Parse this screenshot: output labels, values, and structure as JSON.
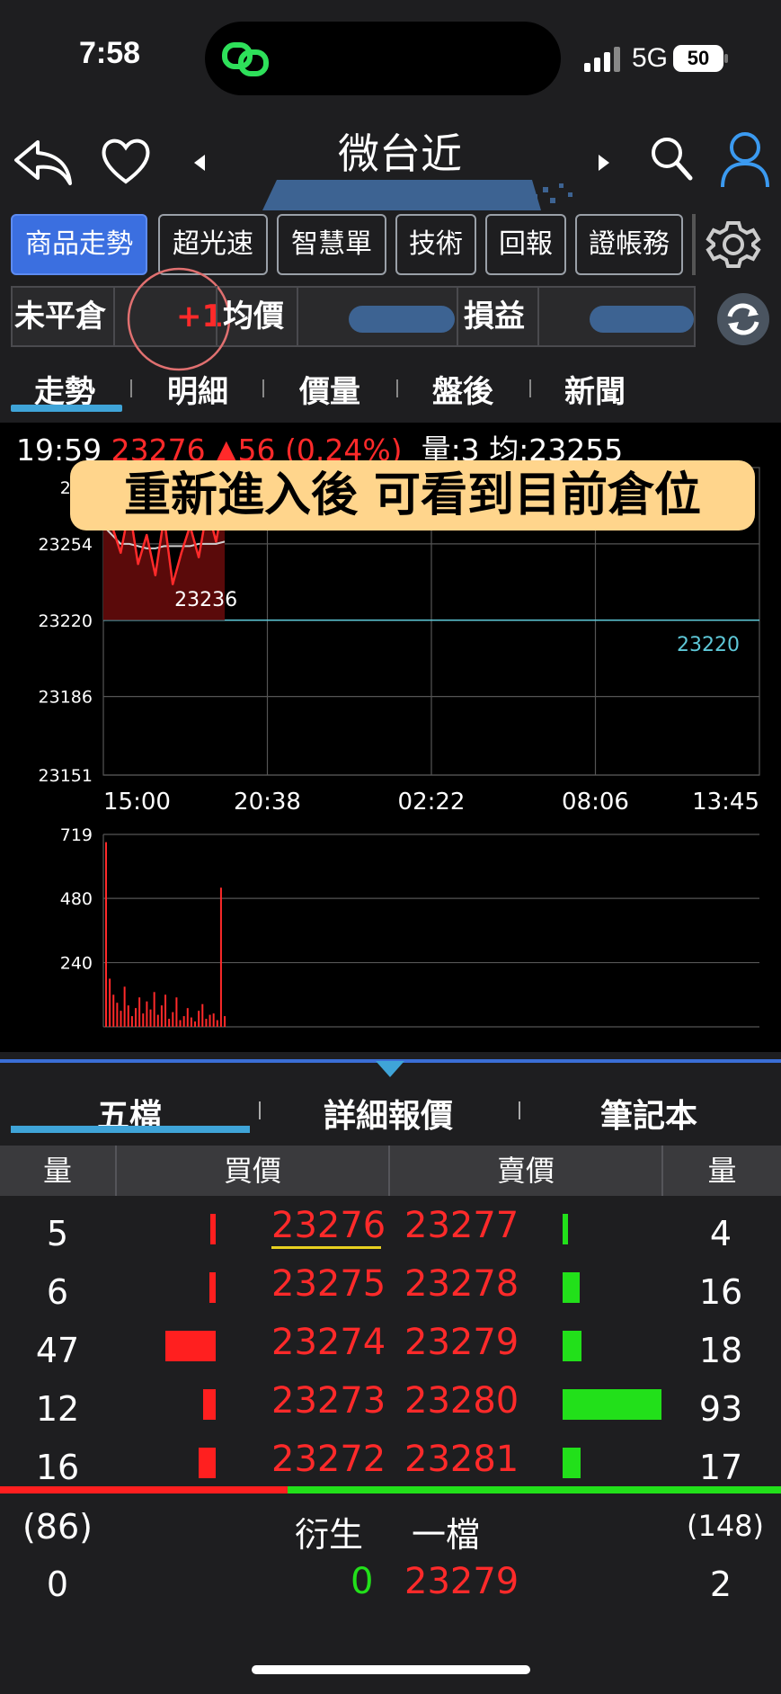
{
  "status": {
    "time": "7:58",
    "network": "5G",
    "battery": "50"
  },
  "header": {
    "title": "微台近"
  },
  "product_tabs": [
    "商品走勢",
    "超光速",
    "智慧單",
    "技術",
    "回報",
    "證帳務"
  ],
  "position": {
    "open_label": "未平倉",
    "open_value": "+1",
    "avg_label": "均價",
    "pl_label": "損益"
  },
  "sub_tabs": [
    "走勢",
    "明細",
    "價量",
    "盤後",
    "新聞"
  ],
  "quote": {
    "time": "19:59",
    "price": "23276",
    "change": "▲56",
    "pct": "(0.24%)",
    "volume_label": "量:3",
    "avg_label": "均:23255"
  },
  "banner": "重新進入後  可看到目前倉位",
  "chart_data": [
    {
      "type": "line",
      "title": "",
      "y_ticks": [
        "23254",
        "23220",
        "23186",
        "23151"
      ],
      "ylim": [
        23151,
        23288
      ],
      "top_tick_partial": "232",
      "x_ticks": [
        "15:00",
        "20:38",
        "02:22",
        "08:06",
        "13:45"
      ],
      "annotations": {
        "low": "23236",
        "reference": "23220"
      },
      "series": [
        {
          "values": [
            23280,
            23262,
            23250,
            23270,
            23245,
            23258,
            23240,
            23266,
            23236,
            23250,
            23262,
            23248,
            23270,
            23255,
            23276
          ]
        },
        {
          "values": [
            23262,
            23258,
            23254,
            23254,
            23253,
            23252,
            23252,
            23253,
            23253,
            23253,
            23253,
            23254,
            23254,
            23254,
            23255
          ]
        }
      ]
    },
    {
      "type": "bar",
      "title": "",
      "y_ticks": [
        "719",
        "480",
        "240"
      ],
      "ylim": [
        0,
        719
      ],
      "values": [
        690,
        180,
        120,
        90,
        60,
        150,
        80,
        40,
        70,
        110,
        50,
        95,
        65,
        130,
        45,
        80,
        120,
        30,
        55,
        110,
        25,
        40,
        70,
        35,
        20,
        60,
        85,
        30,
        45,
        50,
        25,
        520,
        40
      ]
    }
  ],
  "bottom_tabs": [
    "五檔",
    "詳細報價",
    "筆記本"
  ],
  "table_headers": [
    "量",
    "買價",
    "賣價",
    "量"
  ],
  "order_book": [
    {
      "bid_qty": "5",
      "bid": "23276",
      "ask": "23277",
      "ask_qty": "4"
    },
    {
      "bid_qty": "6",
      "bid": "23275",
      "ask": "23278",
      "ask_qty": "16"
    },
    {
      "bid_qty": "47",
      "bid": "23274",
      "ask": "23279",
      "ask_qty": "18"
    },
    {
      "bid_qty": "12",
      "bid": "23273",
      "ask": "23280",
      "ask_qty": "93"
    },
    {
      "bid_qty": "16",
      "bid": "23272",
      "ask": "23281",
      "ask_qty": "17"
    }
  ],
  "totals": {
    "bid_total": "(86)",
    "deriv_label": "衍生",
    "one_label": "一檔",
    "ask_total": "(148)"
  },
  "derived": {
    "left_qty": "0",
    "bid": "0",
    "ask": "23279",
    "right_qty": "2"
  },
  "colors": {
    "up": "#ff2a2a",
    "down": "#22e01a",
    "accent": "#3b6fe0",
    "tab_underline": "#3fa4d8",
    "banner": "#ffd58c"
  }
}
